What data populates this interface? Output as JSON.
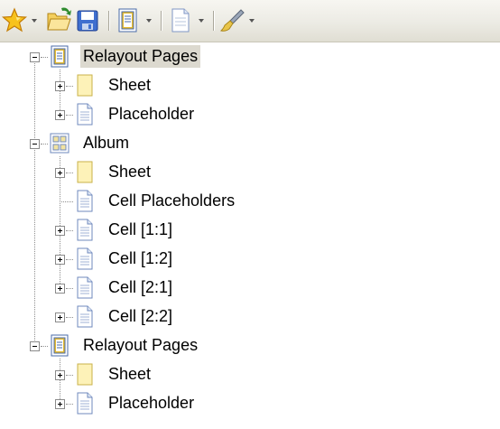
{
  "toolbar": {
    "buttons": [
      {
        "name": "favorites-star-icon"
      },
      {
        "name": "open-folder-icon"
      },
      {
        "name": "save-disk-icon"
      },
      {
        "name": "page-layout-icon"
      },
      {
        "name": "blank-page-icon"
      },
      {
        "name": "brush-icon"
      }
    ]
  },
  "tree": {
    "nodes": [
      {
        "label": "Relayout Pages",
        "icon": "pages-icon",
        "level": 0,
        "expander": "minus",
        "selected": true
      },
      {
        "label": "Sheet",
        "icon": "sheet-icon",
        "level": 1,
        "expander": "plus"
      },
      {
        "label": "Placeholder",
        "icon": "document-icon",
        "level": 1,
        "expander": "plus"
      },
      {
        "label": "Album",
        "icon": "album-grid-icon",
        "level": 0,
        "expander": "minus"
      },
      {
        "label": "Sheet",
        "icon": "sheet-icon",
        "level": 1,
        "expander": "plus"
      },
      {
        "label": "Cell Placeholders",
        "icon": "document-icon",
        "level": 1,
        "expander": "none"
      },
      {
        "label": "Cell [1:1]",
        "icon": "document-icon",
        "level": 1,
        "expander": "plus"
      },
      {
        "label": "Cell [1:2]",
        "icon": "document-icon",
        "level": 1,
        "expander": "plus"
      },
      {
        "label": "Cell [2:1]",
        "icon": "document-icon",
        "level": 1,
        "expander": "plus"
      },
      {
        "label": "Cell [2:2]",
        "icon": "document-icon",
        "level": 1,
        "expander": "plus"
      },
      {
        "label": "Relayout Pages",
        "icon": "pages-icon",
        "level": 0,
        "expander": "minus"
      },
      {
        "label": "Sheet",
        "icon": "sheet-icon",
        "level": 1,
        "expander": "plus"
      },
      {
        "label": "Placeholder",
        "icon": "document-icon",
        "level": 1,
        "expander": "plus"
      }
    ]
  },
  "colors": {
    "toolbar_top": "#f7f6f1",
    "toolbar_bottom": "#e0ded3",
    "selection": "#dcd9cf"
  }
}
